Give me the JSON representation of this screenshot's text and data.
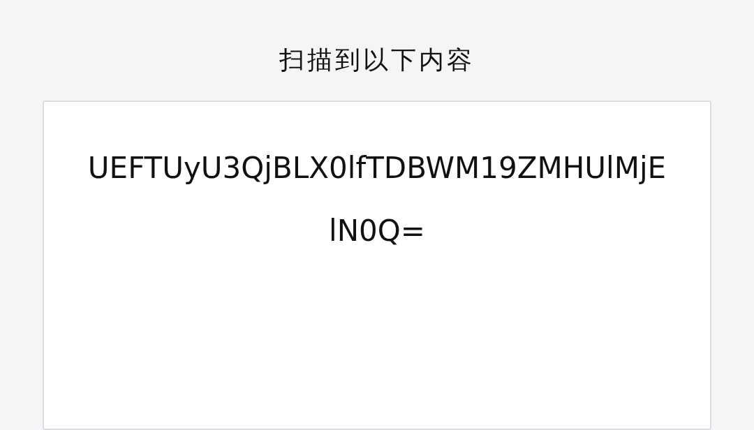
{
  "title": "扫描到以下内容",
  "result": {
    "text": "UEFTUyU3QjBLX0lfTDBWM19ZMHUlMjElN0Q="
  }
}
